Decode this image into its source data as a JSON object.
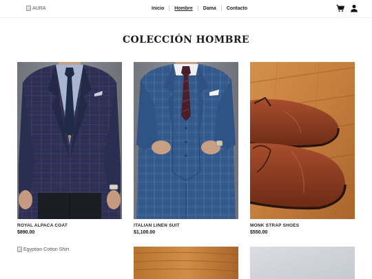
{
  "nav": {
    "brand_alt": "AURA",
    "links": [
      {
        "label": "Inicio",
        "active": false
      },
      {
        "label": "Hombre",
        "active": true
      },
      {
        "label": "Dama",
        "active": false
      },
      {
        "label": "Contacto",
        "active": false
      }
    ],
    "icons": [
      "cart-icon",
      "user-icon"
    ]
  },
  "page": {
    "title": "COLECCIÓN HOMBRE"
  },
  "products": [
    {
      "name": "ROYAL ALPACA COAT",
      "price": "$890.00",
      "image": "navy-plaid-blazer"
    },
    {
      "name": "ITALIAN LINEN SUIT",
      "price": "$1,100.00",
      "image": "blue-check-three-piece-suit"
    },
    {
      "name": "MONK STRAP SHOES",
      "price": "$550.00",
      "image": "brown-leather-shoes"
    }
  ],
  "next_row": {
    "broken_image_alt": "Egyptian Cotton Shirt"
  },
  "colors": {
    "blazer": "#2d3155",
    "suit": "#33598c",
    "shoe": "#8c3a22",
    "wood": "#c4803e"
  }
}
